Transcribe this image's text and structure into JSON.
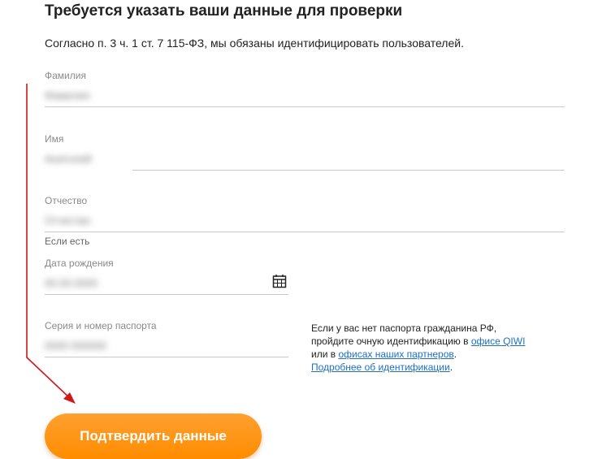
{
  "header": {
    "title": "Требуется указать ваши данные для проверки",
    "subtitle": "Согласно п. 3 ч. 1 ст. 7 115-ФЗ, мы обязаны идентифицировать пользователей."
  },
  "form": {
    "surname": {
      "label": "Фамилия",
      "value": "Фамилия"
    },
    "name": {
      "label": "Имя",
      "value": "Анатолий"
    },
    "patronymic": {
      "label": "Отчество",
      "value": "Отчество",
      "hint": "Если есть"
    },
    "birthdate": {
      "label": "Дата рождения",
      "value": "00.00.0000"
    },
    "passport": {
      "label": "Серия и номер паспорта",
      "value": "0000 000000"
    }
  },
  "aside": {
    "line1": "Если у вас нет паспорта гражданина РФ,",
    "line2_text": "пройдите очную идентификацию в ",
    "link_qiwi": "офисе QIWI",
    "line3_text": "или в ",
    "link_partners": "офисах наших партнеров",
    "line3_end": ".",
    "link_more": "Подробнее об идентификации",
    "line4_end": "."
  },
  "submit": {
    "label": "Подтвердить данные"
  },
  "colors": {
    "accent": "#ff8c00",
    "link": "#1f6fc5",
    "arrow": "#d01818"
  },
  "icons": {
    "calendar": "calendar-icon"
  }
}
